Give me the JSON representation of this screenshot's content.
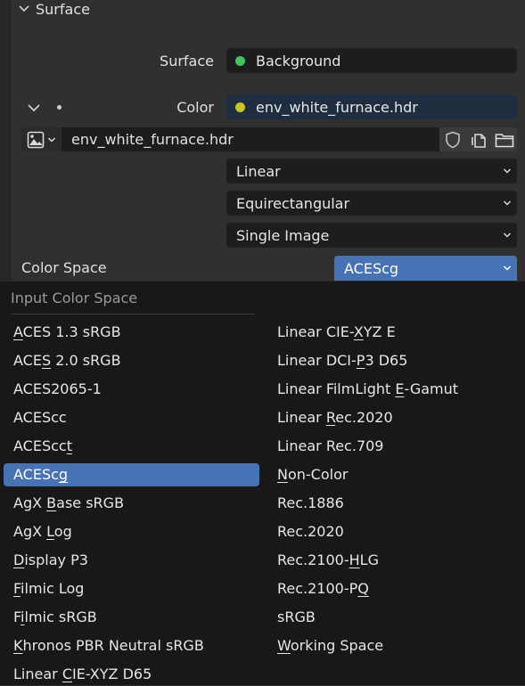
{
  "panel": {
    "section_title": "Surface",
    "surface_label": "Surface",
    "surface_value": "Background",
    "surface_dot_color": "#3ec45a",
    "color_label": "Color",
    "color_value": "env_white_furnace.hdr",
    "color_dot_color": "#c8c425",
    "image_name": "env_white_furnace.hdr",
    "interpolation": "Linear",
    "projection": "Equirectangular",
    "source": "Single Image",
    "color_space_label": "Color Space",
    "color_space_value": "ACEScg",
    "accent": "#4772b3"
  },
  "popup": {
    "title": "Input Color Space",
    "col1": [
      {
        "pre": "",
        "u": "A",
        "post": "CES 1.3 sRGB"
      },
      {
        "pre": "ACE",
        "u": "S",
        "post": " 2.0 sRGB"
      },
      {
        "pre": "ACES2065-1",
        "u": "",
        "post": ""
      },
      {
        "pre": "ACEScc",
        "u": "",
        "post": ""
      },
      {
        "pre": "ACEScc",
        "u": "t",
        "post": ""
      },
      {
        "pre": "ACESc",
        "u": "g",
        "post": "",
        "selected": true
      },
      {
        "pre": "AgX ",
        "u": "B",
        "post": "ase sRGB"
      },
      {
        "pre": "AgX ",
        "u": "L",
        "post": "og"
      },
      {
        "pre": "",
        "u": "D",
        "post": "isplay P3"
      },
      {
        "pre": "",
        "u": "F",
        "post": "ilmic Log"
      },
      {
        "pre": "F",
        "u": "i",
        "post": "lmic sRGB"
      },
      {
        "pre": "",
        "u": "K",
        "post": "hronos PBR Neutral sRGB"
      },
      {
        "pre": "Linear ",
        "u": "C",
        "post": "IE-XYZ D65"
      }
    ],
    "col2": [
      {
        "pre": "Linear CIE-",
        "u": "X",
        "post": "YZ E"
      },
      {
        "pre": "Linear DCI-",
        "u": "P",
        "post": "3 D65"
      },
      {
        "pre": "Linear FilmLight ",
        "u": "E",
        "post": "-Gamut"
      },
      {
        "pre": "Linear ",
        "u": "R",
        "post": "ec.2020"
      },
      {
        "pre": "Linear Rec.709",
        "u": "",
        "post": ""
      },
      {
        "pre": "",
        "u": "N",
        "post": "on-Color"
      },
      {
        "pre": "Rec.1886",
        "u": "",
        "post": ""
      },
      {
        "pre": "Rec.2020",
        "u": "",
        "post": ""
      },
      {
        "pre": "Rec.2100-",
        "u": "H",
        "post": "LG"
      },
      {
        "pre": "Rec.2100-P",
        "u": "Q",
        "post": ""
      },
      {
        "pre": "sRGB",
        "u": "",
        "post": ""
      },
      {
        "pre": "",
        "u": "W",
        "post": "orking Space"
      }
    ]
  }
}
